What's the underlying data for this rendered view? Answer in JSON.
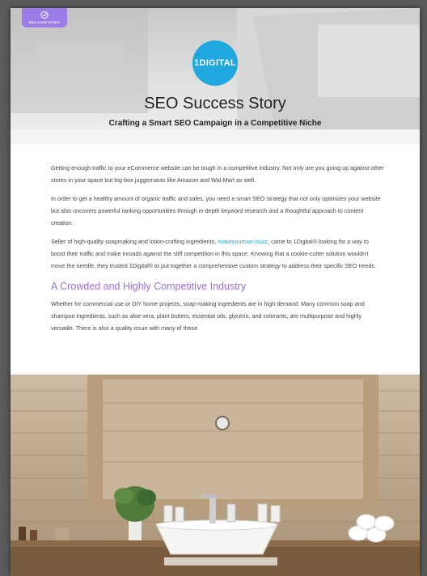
{
  "badge": {
    "label": "SEO CASE STUDY",
    "icon": "target-icon"
  },
  "logo": {
    "text": "1DIGITAL"
  },
  "hero": {
    "title": "SEO Success Story",
    "subtitle": "Crafting a Smart SEO Campaign in a Competitive Niche"
  },
  "paragraphs": {
    "p1": "Getting enough traffic to your eCommerce website can be tough in a competitive industry. Not only are you going up against other stores in your space but big-box juggernauts like Amazon and Wal-Mart as well.",
    "p2": "In order to get a healthy amount of organic traffic and sales, you need a smart SEO strategy that not only optimizes your website but also uncovers powerful ranking opportunities through in-depth keyword research and a thoughtful approach to content creation.",
    "p3_start": "Seller of high-quality soapmaking and lotion-crafting ingredients, ",
    "p3_link": "makeyourown.buzz",
    "p3_end": ", came to 1Digital® looking for a way to boost their traffic and make inroads against the stiff competition in this space. Knowing that a cookie-cutter solution wouldn't move the needle, they trusted 1Digital® to put together a comprehensive custom strategy to address their specific SEO needs.",
    "heading": "A Crowded and Highly Competitive Industry",
    "p4": "Whether for commercial use or DIY home projects, soap-making ingredients are in high demand. Many common soap and shampoo ingredients, such as aloe vera, plant butters, essential oils, glycerin, and colorants, are multipurpose and highly versatile. There is also a quality issue with many of these"
  },
  "colors": {
    "accent_purple": "#9b6fe0",
    "brand_blue": "#1ea8df",
    "badge": "#9b7de8"
  }
}
